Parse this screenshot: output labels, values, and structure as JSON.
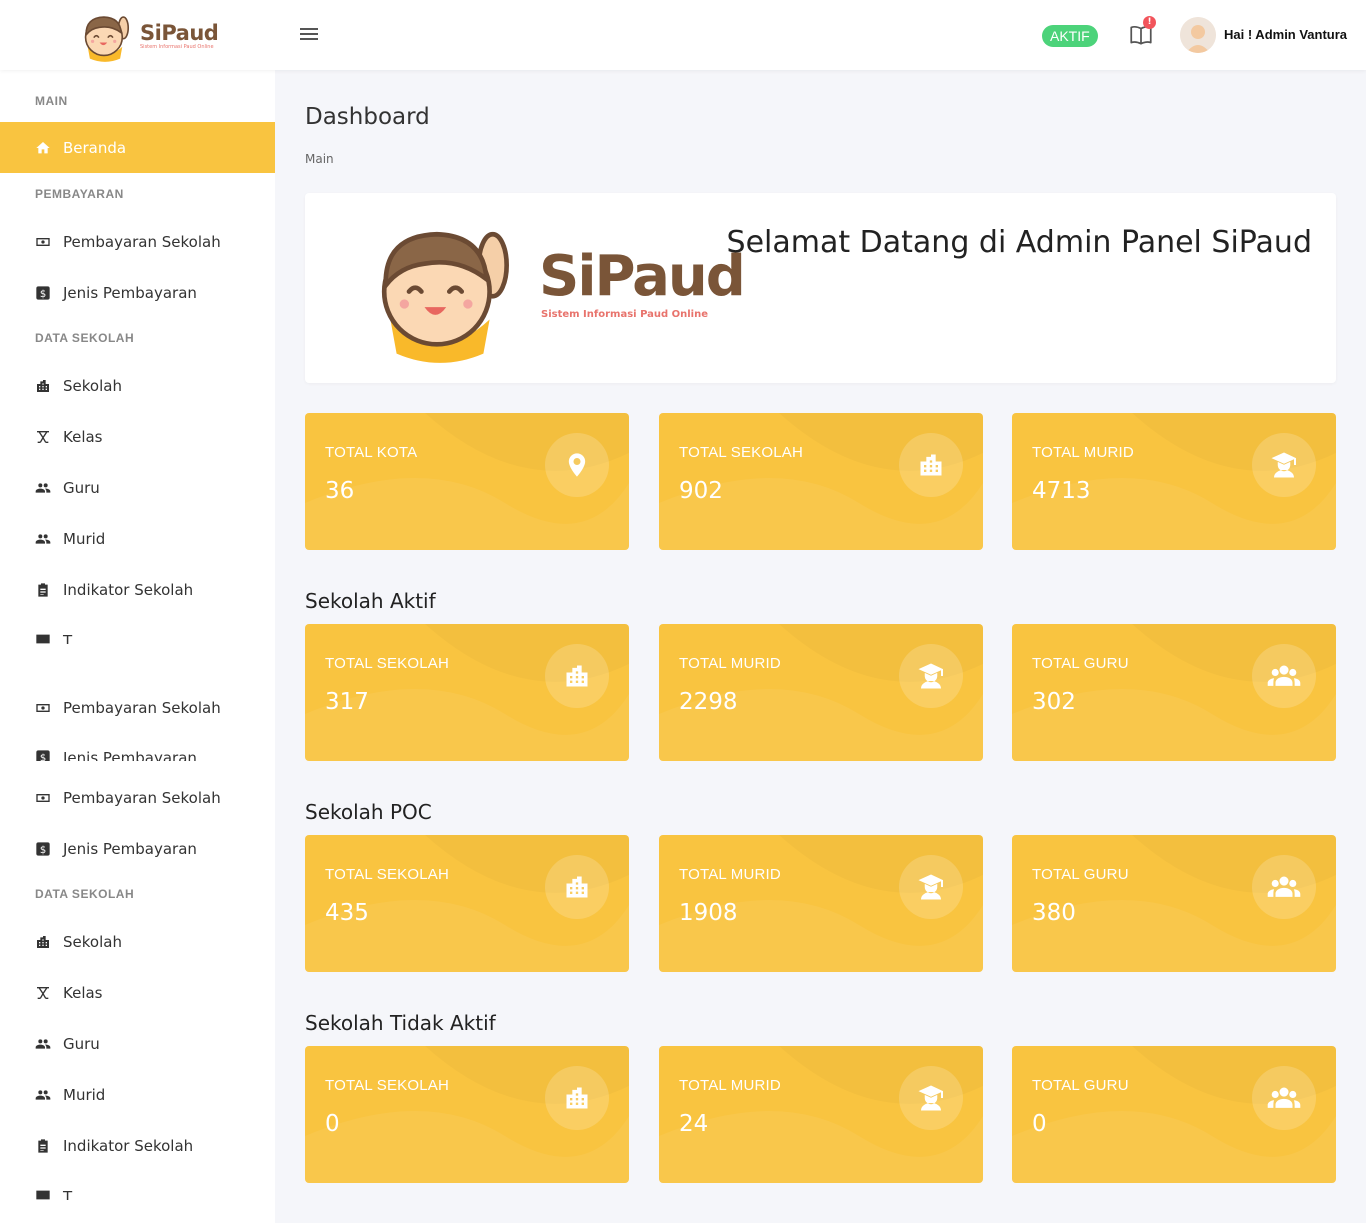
{
  "brand": {
    "name": "SiPaud",
    "subtitle": "Sistem Informasi Paud Online"
  },
  "header": {
    "status": "AKTIF",
    "notification_count": "!",
    "greeting": "Hai ! Admin Vantura"
  },
  "sidebar": {
    "sections": {
      "main": "MAIN",
      "pembayaran": "PEMBAYARAN",
      "data_sekolah": "DATA SEKOLAH",
      "data_sekolah_2": "DATA SEKOLAH"
    },
    "items": [
      {
        "label": "Beranda",
        "icon": "home-icon"
      },
      {
        "label": "Pembayaran Sekolah",
        "icon": "money-icon"
      },
      {
        "label": "Jenis Pembayaran",
        "icon": "dollar-icon"
      },
      {
        "label": "Sekolah",
        "icon": "building-icon"
      },
      {
        "label": "Kelas",
        "icon": "class-icon"
      },
      {
        "label": "Guru",
        "icon": "people-icon"
      },
      {
        "label": "Murid",
        "icon": "people-icon"
      },
      {
        "label": "Indikator Sekolah",
        "icon": "clipboard-icon"
      },
      {
        "label": "T",
        "icon": "monitor-icon"
      },
      {
        "label": "Pembayaran Sekolah",
        "icon": "money-icon"
      },
      {
        "label": "Jenis Pembayaran",
        "icon": "dollar-icon"
      },
      {
        "label": "Pembayaran Sekolah",
        "icon": "money-icon"
      },
      {
        "label": "Jenis Pembayaran",
        "icon": "dollar-icon"
      },
      {
        "label": "Sekolah",
        "icon": "building-icon"
      },
      {
        "label": "Kelas",
        "icon": "class-icon"
      },
      {
        "label": "Guru",
        "icon": "people-icon"
      },
      {
        "label": "Murid",
        "icon": "people-icon"
      },
      {
        "label": "Indikator Sekolah",
        "icon": "clipboard-icon"
      },
      {
        "label": "T",
        "icon": "monitor-icon"
      }
    ]
  },
  "page": {
    "title": "Dashboard",
    "breadcrumb": "Main",
    "welcome": "Selamat Datang di Admin Panel SiPaud"
  },
  "summary": [
    {
      "label": "TOTAL KOTA",
      "value": "36",
      "icon": "map-pin-icon"
    },
    {
      "label": "TOTAL SEKOLAH",
      "value": "902",
      "icon": "building-icon"
    },
    {
      "label": "TOTAL MURID",
      "value": "4713",
      "icon": "graduate-icon"
    }
  ],
  "groups": [
    {
      "title": "Sekolah Aktif",
      "stats": [
        {
          "label": "TOTAL SEKOLAH",
          "value": "317",
          "icon": "building-icon"
        },
        {
          "label": "TOTAL MURID",
          "value": "2298",
          "icon": "graduate-icon"
        },
        {
          "label": "TOTAL GURU",
          "value": "302",
          "icon": "users-icon"
        }
      ]
    },
    {
      "title": "Sekolah POC",
      "stats": [
        {
          "label": "TOTAL SEKOLAH",
          "value": "435",
          "icon": "building-icon"
        },
        {
          "label": "TOTAL MURID",
          "value": "1908",
          "icon": "graduate-icon"
        },
        {
          "label": "TOTAL GURU",
          "value": "380",
          "icon": "users-icon"
        }
      ]
    },
    {
      "title": "Sekolah Tidak Aktif",
      "stats": [
        {
          "label": "TOTAL SEKOLAH",
          "value": "0",
          "icon": "building-icon"
        },
        {
          "label": "TOTAL MURID",
          "value": "24",
          "icon": "graduate-icon"
        },
        {
          "label": "TOTAL GURU",
          "value": "0",
          "icon": "users-icon"
        }
      ]
    }
  ],
  "colors": {
    "accent": "#f9c440",
    "status": "#4cd37a",
    "notification": "#f2545b",
    "brand": "#7a5538"
  }
}
